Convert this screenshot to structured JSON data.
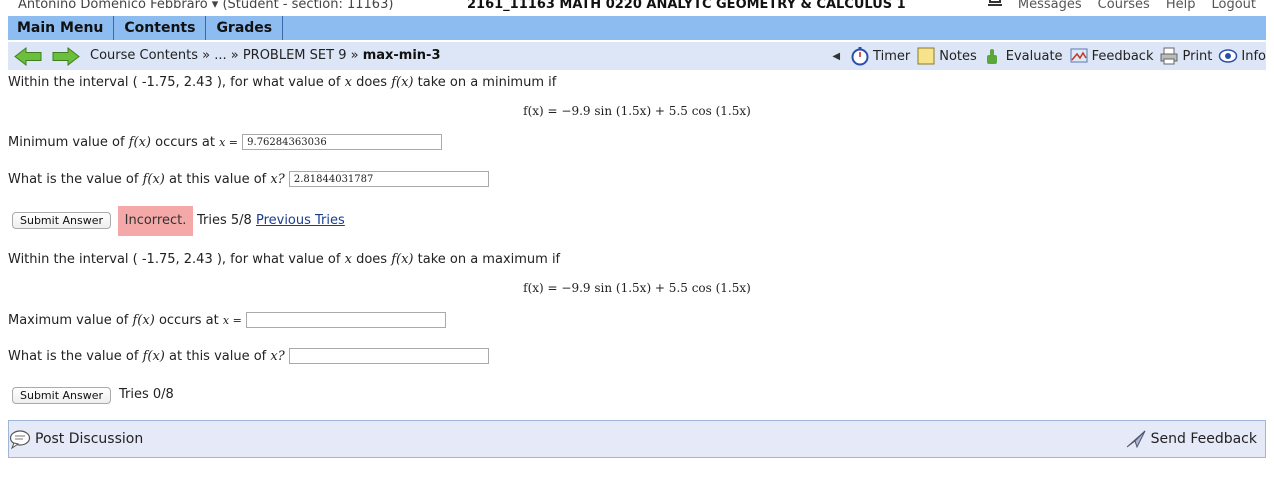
{
  "topbar": {
    "user": "Antonino Domenico Febbraro ▾ (Student - section: 11163)",
    "course_title": "2161_11163 MATH 0220 ANALYTC GEOMETRY & CALCULUS 1",
    "links": [
      "Messages",
      "Courses",
      "Help",
      "Logout"
    ]
  },
  "menu": {
    "tabs": [
      "Main Menu",
      "Contents",
      "Grades"
    ]
  },
  "nav": {
    "breadcrumb_prefix": "Course Contents » ... » PROBLEM SET 9 »",
    "breadcrumb_current": "max-min-3",
    "tools": {
      "timer": "Timer",
      "notes": "Notes",
      "evaluate": "Evaluate",
      "feedback": "Feedback",
      "print": "Print",
      "info": "Info"
    }
  },
  "problem1": {
    "question_a": "Within the interval ( -1.75, 2.43 ), for what value of",
    "question_var": "x",
    "question_b": "does",
    "question_fx": "f(x)",
    "question_c": "take on a minimum if",
    "formula": "f(x) = −9.9 sin (1.5x) + 5.5 cos (1.5x)",
    "loc_label": "Minimum value of",
    "loc_fx": "f(x)",
    "loc_tail": "occurs at",
    "loc_eq": "x =",
    "loc_value": "9.76284363036",
    "val_label": "What is the value of",
    "val_fx": "f(x)",
    "val_mid": "at this value of",
    "val_x": "x?",
    "val_value": "2.81844031787",
    "submit": "Submit Answer",
    "status": "Incorrect.",
    "tries": "Tries 5/8",
    "previous": "Previous Tries"
  },
  "problem2": {
    "question_a": "Within the interval ( -1.75, 2.43 ), for what value of",
    "question_var": "x",
    "question_b": "does",
    "question_fx": "f(x)",
    "question_c": "take on a maximum if",
    "formula": "f(x) = −9.9 sin (1.5x) + 5.5 cos (1.5x)",
    "loc_label": "Maximum value of",
    "loc_fx": "f(x)",
    "loc_tail": "occurs at",
    "loc_eq": "x =",
    "loc_value": "",
    "val_label": "What is the value of",
    "val_fx": "f(x)",
    "val_mid": "at this value of",
    "val_x": "x?",
    "val_value": "",
    "submit": "Submit Answer",
    "tries": "Tries 0/8"
  },
  "footer": {
    "post_discussion": "Post Discussion",
    "send_feedback": "Send Feedback"
  }
}
